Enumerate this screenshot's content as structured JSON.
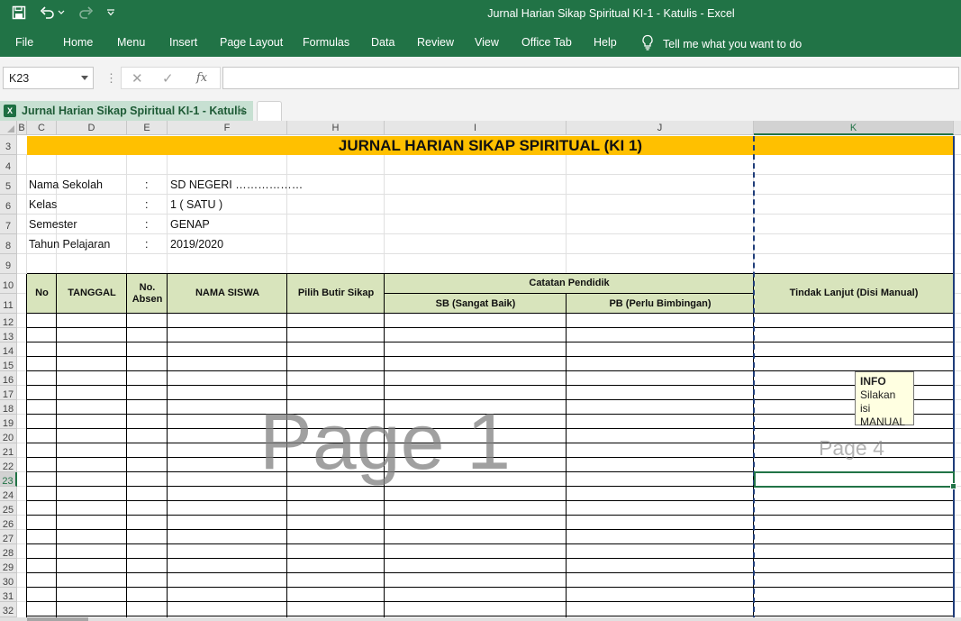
{
  "app": {
    "window_title": "Jurnal Harian Sikap Spiritual KI-1 - Katulis  -  Excel"
  },
  "quick_access": [
    {
      "icon": "save-icon"
    },
    {
      "icon": "undo-icon"
    },
    {
      "icon": "redo-icon"
    },
    {
      "icon": "customize-qat-icon"
    }
  ],
  "ribbon": {
    "tabs": [
      "File",
      "Home",
      "Menu",
      "Insert",
      "Page Layout",
      "Formulas",
      "Data",
      "Review",
      "View",
      "Office Tab",
      "Help"
    ],
    "tell_me": "Tell me what you want to do"
  },
  "formula_bar": {
    "name_box": "K23",
    "formula": ""
  },
  "workbook_tab": {
    "label": "Jurnal Harian Sikap Spiritual KI-1 - Katulis"
  },
  "columns": [
    "B",
    "C",
    "D",
    "E",
    "F",
    "H",
    "I",
    "J",
    "K"
  ],
  "rows": [
    "3",
    "4",
    "5",
    "6",
    "7",
    "8",
    "9",
    "10",
    "11",
    "12",
    "13",
    "14",
    "15",
    "16",
    "17",
    "18",
    "19",
    "20",
    "21",
    "22",
    "23",
    "24",
    "25",
    "26",
    "27",
    "28",
    "29",
    "30",
    "31",
    "32"
  ],
  "sheet": {
    "title": "JURNAL HARIAN SIKAP SPIRITUAL (KI 1)",
    "info": [
      {
        "label": "Nama Sekolah",
        "sep": ":",
        "value": "SD NEGERI ………………"
      },
      {
        "label": "Kelas",
        "sep": ":",
        "value": "1 ( SATU )"
      },
      {
        "label": "Semester",
        "sep": ":",
        "value": "GENAP"
      },
      {
        "label": "Tahun Pelajaran",
        "sep": ":",
        "value": "2019/2020"
      }
    ],
    "headers": {
      "no": "No",
      "tanggal": "TANGGAL",
      "no_absen_1": "No.",
      "no_absen_2": "Absen",
      "nama_siswa": "NAMA SISWA",
      "pilih_butir": "Pilih Butir Sikap",
      "catatan": "Catatan Pendidik",
      "sb": "SB (Sangat Baik)",
      "pb": "PB (Perlu Bimbingan)",
      "tindak_lanjut": "Tindak Lanjut (Disi Manual)"
    },
    "watermark_page1": "Page 1",
    "watermark_page4": "Page 4"
  },
  "tooltip": {
    "title": "INFO",
    "line1": "Silakan isi",
    "line2": "MANUAL"
  },
  "colors": {
    "excel_green": "#217346",
    "title_fill": "#ffc000",
    "header_fill": "#d8e4bc",
    "tab_fill": "#c7e0d2"
  }
}
